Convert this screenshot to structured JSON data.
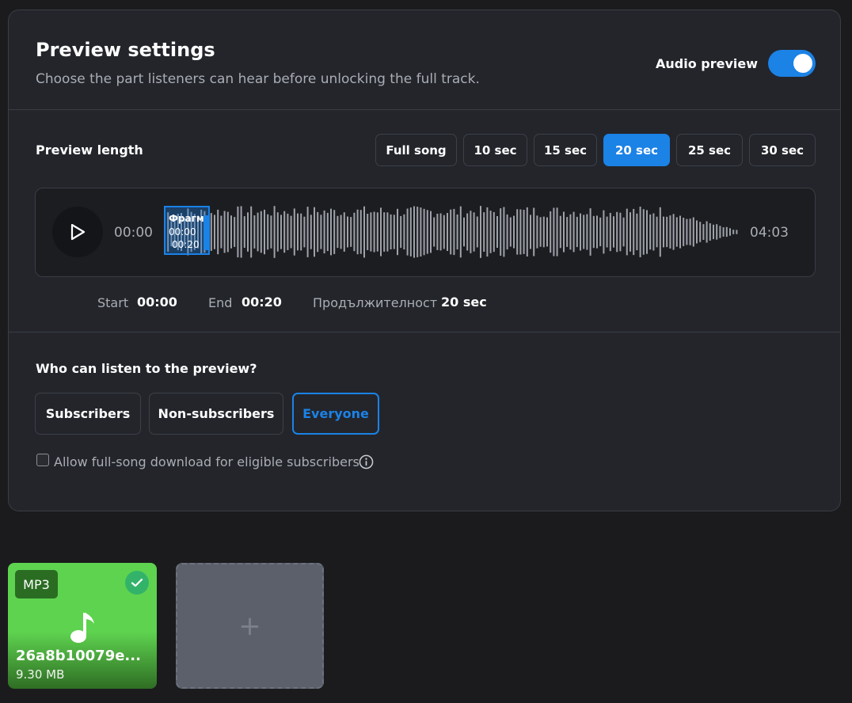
{
  "header": {
    "title": "Preview settings",
    "subtitle": "Choose the part listeners can hear before unlocking the full track.",
    "toggle_label": "Audio preview",
    "toggle_on": true
  },
  "preview_length": {
    "label": "Preview length",
    "options": [
      "Full song",
      "10 sec",
      "15 sec",
      "20 sec",
      "25 sec",
      "30 sec"
    ],
    "selected": "20 sec"
  },
  "player": {
    "current_time": "00:00",
    "total_time": "04:03",
    "selection_label": "Фрагмент",
    "selection_start": "00:00",
    "selection_end": "00:20"
  },
  "range": {
    "start_label": "Start",
    "start_value": "00:00",
    "end_label": "End",
    "end_value": "00:20",
    "duration_label": "Продължителност",
    "duration_value": "20 sec"
  },
  "audience": {
    "question": "Who can listen to the preview?",
    "options": [
      "Subscribers",
      "Non-subscribers",
      "Everyone"
    ],
    "selected": "Everyone"
  },
  "download": {
    "label": "Allow full-song download for eligible subscribers",
    "checked": false
  },
  "file": {
    "badge": "MP3",
    "name": "26a8b10079e...",
    "size": "9.30 MB"
  },
  "colors": {
    "accent": "#1b82e6",
    "file_card": "#5ed34f"
  }
}
